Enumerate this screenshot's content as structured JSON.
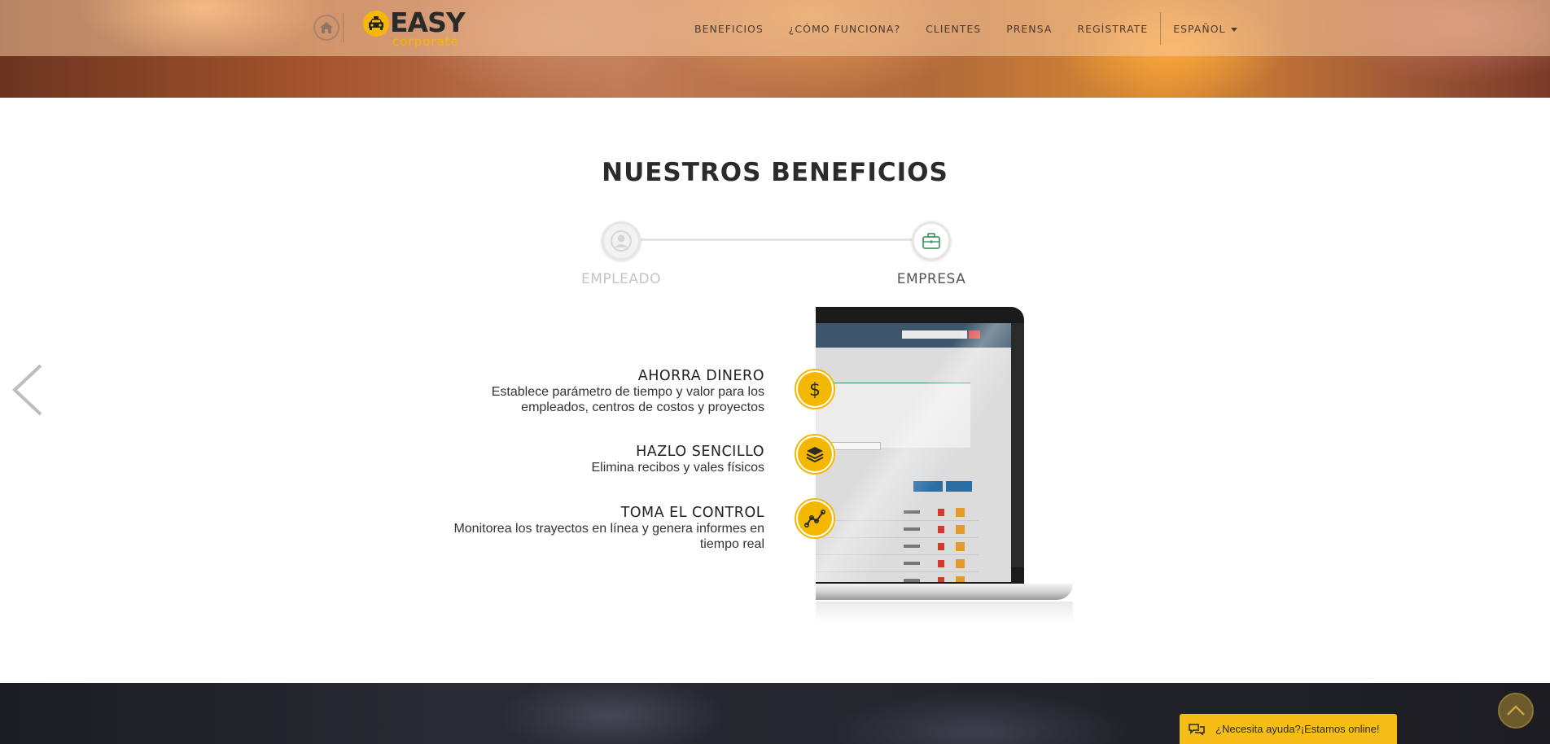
{
  "header": {
    "logo": {
      "brand": "EASY",
      "sub": "corporate"
    },
    "nav": [
      {
        "label": "BENEFICIOS"
      },
      {
        "label": "¿CÓMO FUNCIONA?"
      },
      {
        "label": "CLIENTES"
      },
      {
        "label": "PRENSA"
      },
      {
        "label": "REGÍSTRATE"
      }
    ],
    "language": "ESPAÑOL"
  },
  "benefits": {
    "title": "NUESTROS BENEFICIOS",
    "toggle": {
      "employee_label": "EMPLEADO",
      "company_label": "EMPRESA",
      "active": "company"
    },
    "features": [
      {
        "title": "AHORRA DINERO",
        "desc": "Establece parámetro de tiempo y valor para los empleados, centros de costos y proyectos",
        "icon": "dollar-icon"
      },
      {
        "title": "HAZLO SENCILLO",
        "desc": "Elimina recibos y vales físicos",
        "icon": "layers-icon"
      },
      {
        "title": "TOMA EL CONTROL",
        "desc": "Monitorea los trayectos en línea y genera informes en tiempo real",
        "icon": "chart-line-icon"
      }
    ]
  },
  "chat": {
    "label": "¿Necesita ayuda?¡Estamos online!"
  },
  "colors": {
    "accent": "#f6b800",
    "dark_band": "#22222a"
  }
}
